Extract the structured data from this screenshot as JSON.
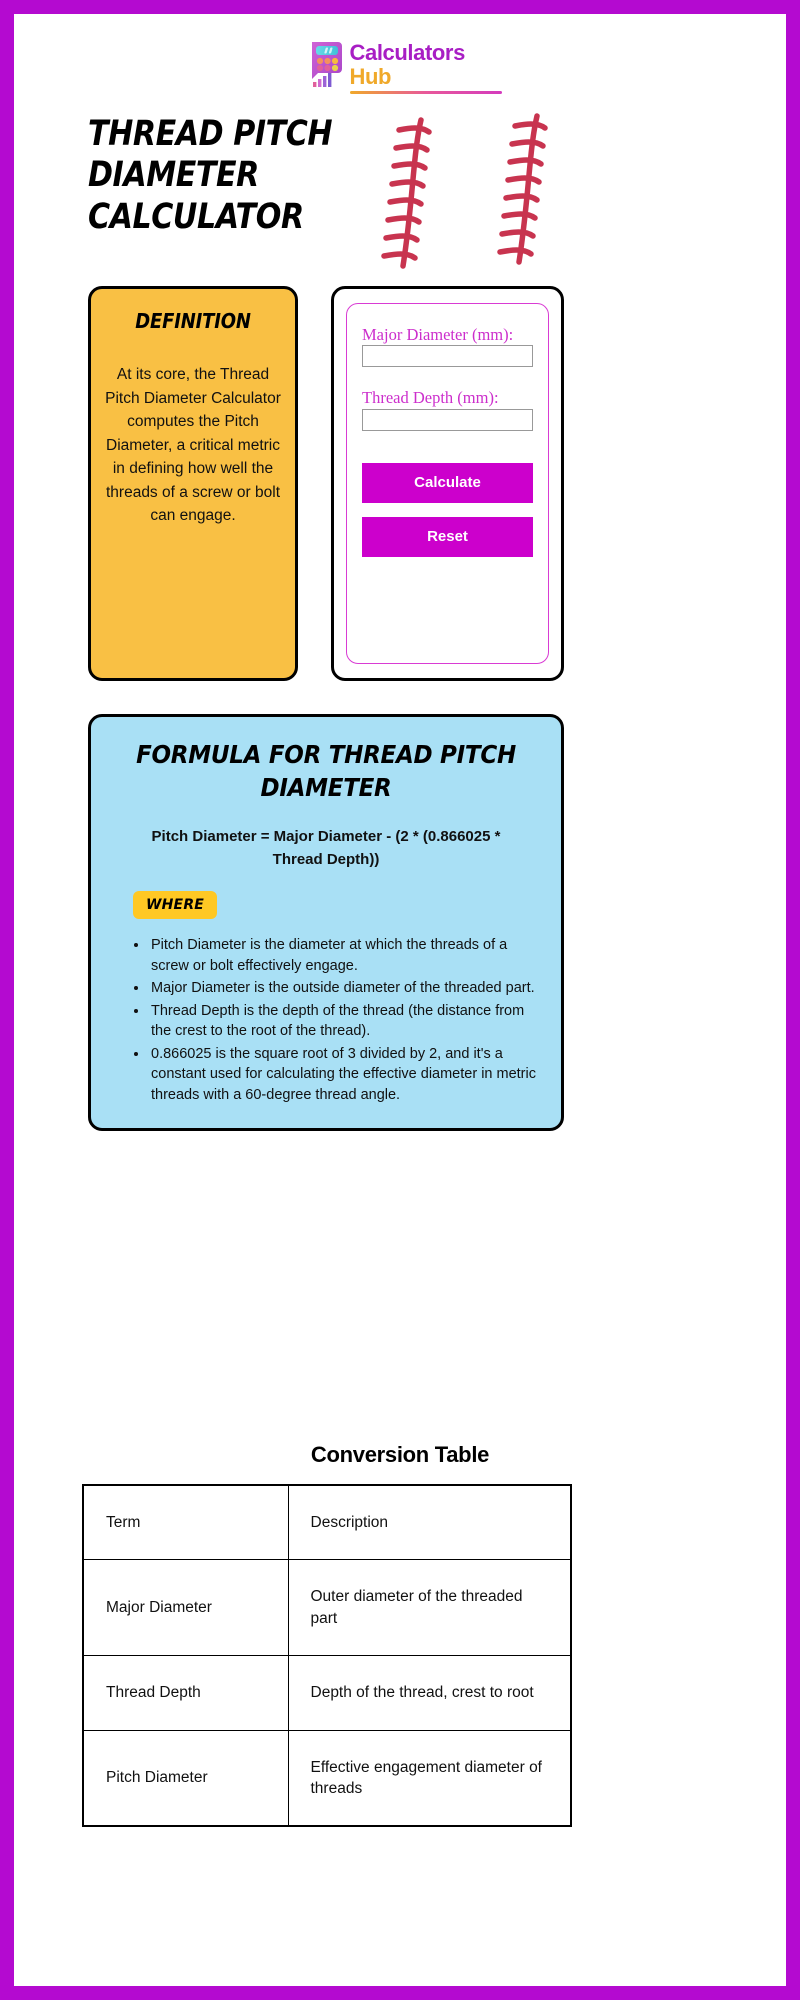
{
  "brand": {
    "line1": "Calculators",
    "line2": "Hub",
    "mark_icon": "calculator-icon",
    "accent_purple": "#a81ec4",
    "accent_yellow": "#f0a92a"
  },
  "page": {
    "title": "THREAD PITCH DIAMETER CALCULATOR",
    "border_color": "#b40ad0",
    "decoration_icon": "baseball-stitch-decoration",
    "decoration_color": "#c8344f"
  },
  "definition": {
    "heading": "DEFINITION",
    "body": "At its core, the Thread Pitch Diameter Calculator computes the Pitch Diameter, a critical metric in defining how well the threads of a screw or bolt can engage.",
    "bg_color": "#f9c044"
  },
  "calculator": {
    "fields": [
      {
        "label": "Major Diameter (mm):",
        "value": "",
        "placeholder": ""
      },
      {
        "label": "Thread Depth (mm):",
        "value": "",
        "placeholder": ""
      }
    ],
    "calculate_label": "Calculate",
    "reset_label": "Reset",
    "button_color": "#cc00cc",
    "label_color": "#cc2ecc"
  },
  "formula": {
    "heading": "FORMULA FOR THREAD PITCH DIAMETER",
    "equation": "Pitch Diameter = Major Diameter - (2 * (0.866025 * Thread Depth))",
    "where_label": "WHERE",
    "bg_color": "#a9e0f5",
    "items": [
      "Pitch Diameter is the diameter at which the threads of a screw or bolt effectively engage.",
      "Major Diameter is the outside diameter of the threaded part.",
      "Thread Depth is the depth of the thread (the distance from the crest to the root of the thread).",
      "0.866025 is the square root of 3 divided by 2, and it's a constant used for calculating the effective diameter in metric threads with a 60-degree thread angle."
    ]
  },
  "conversion_table": {
    "title": "Conversion Table",
    "headers": [
      "Term",
      "Description"
    ],
    "rows": [
      [
        "Major Diameter",
        "Outer diameter of the threaded part"
      ],
      [
        "Thread Depth",
        "Depth of the thread, crest to root"
      ],
      [
        "Pitch Diameter",
        "Effective engagement diameter of threads"
      ]
    ]
  }
}
